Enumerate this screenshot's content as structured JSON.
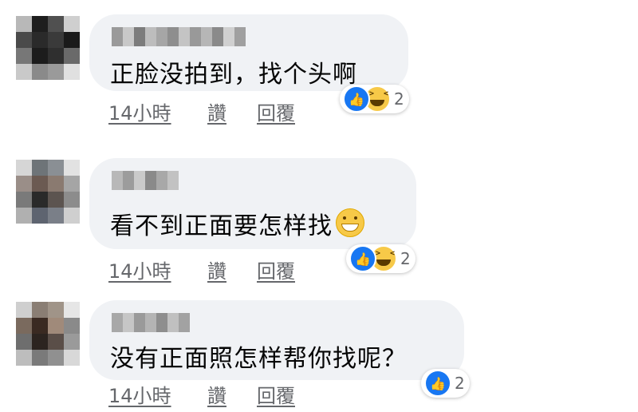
{
  "comments": [
    {
      "text": "正脸没拍到，找个头啊",
      "time": "14小時",
      "like": "讚",
      "reply": "回覆",
      "reaction_count": "2",
      "reactions": [
        "like-icon",
        "haha-icon"
      ]
    },
    {
      "text": "看不到正面要怎样找",
      "emoji": "grinning-sweat-icon",
      "time": "14小時",
      "like": "讚",
      "reply": "回覆",
      "reaction_count": "2",
      "reactions": [
        "like-icon",
        "haha-icon"
      ]
    },
    {
      "text": "没有正面照怎样帮你找呢？",
      "time": "14小時",
      "like": "讚",
      "reply": "回覆",
      "reaction_count": "2",
      "reactions": [
        "like-icon"
      ]
    }
  ],
  "colors": {
    "bubble": "#f0f2f5",
    "meta_text": "#65676b",
    "like_blue": "#1877f2",
    "haha_yellow": "#f7c948"
  }
}
